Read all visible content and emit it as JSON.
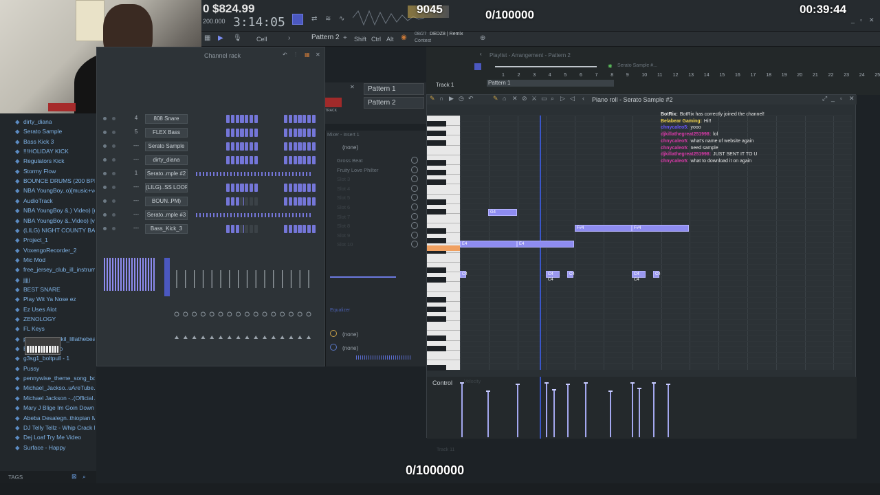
{
  "overlay": {
    "money": "$824.99",
    "money_prefix": "0",
    "counter_center": "9045",
    "goal_top": "0/100000",
    "timer": "00:39:44",
    "goal_bottom": "0/1000000"
  },
  "toolbar": {
    "song_time": "3:14:05",
    "tempo": "200.000",
    "tool_cell": "Cell",
    "pattern": "Pattern 2",
    "shift": "Shift",
    "ctrl": "Ctrl",
    "alt": "Alt",
    "hint_date": "08/27",
    "hint_title": "DEDZ8 | Remix",
    "hint_sub": "Contest"
  },
  "browser": {
    "items": [
      "dirty_diana",
      "Serato Sample",
      "Bass Kick 3",
      "!!!HOLIDAY KICK",
      "Regulators Kick",
      "Stormy Flow",
      "BOUNCE DRUMS (200 BPM)",
      "NBA YoungBoy..o)[music+vocals]",
      "AudioTrack",
      "NBA YoungBoy &.) Video) [music]",
      "NBA YoungBoy &..Video) [vocals]",
      "(LILG) NIGHT COUNTY BASS LOOP",
      "Project_1",
      "VoxengoRecorder_2",
      "Mic Mod",
      "free_jersey_club_ill_instrumental",
      "jjjjj",
      "BEST SNARE",
      "Play Wit Ya Nose ez",
      "Ez Uses Alot",
      "ZENOLOGY",
      "FL Keys",
      "penny (prod.djkil_lillathebeatplug",
      "Basic 808 Clap",
      "g3sg1_boltpull - 1",
      "Pussy",
      "pennywise_theme_song_bq",
      "Michael_Jackso..uAreTube.com_)",
      "Michael Jackson -..(Official Audio)",
      "Mary J Blige  Im Goin Down",
      "Abeba Desalegn..thiopian Music",
      "DJ Telly Tellz - Whip Crack Loop",
      "Dej Loaf  Try Me Video",
      "Surface - Happy"
    ],
    "tags_label": "TAGS"
  },
  "channel_rack": {
    "title": "Channel rack",
    "rows": [
      {
        "num": "4",
        "name": "808 Snare"
      },
      {
        "num": "5",
        "name": "FLEX Bass"
      },
      {
        "num": "---",
        "name": "Serato Sample"
      },
      {
        "num": "---",
        "name": "dirty_diana"
      },
      {
        "num": "1",
        "name": "Serato..mple #2"
      },
      {
        "num": "---",
        "name": "(LILG)..SS LOOP"
      },
      {
        "num": "---",
        "name": "BOUN..PM)"
      },
      {
        "num": "---",
        "name": "Serato..mple #3"
      },
      {
        "num": "---",
        "name": "Bass_Kick_3"
      }
    ]
  },
  "mixer": {
    "title": "Mixer - Insert 1",
    "slot_none": "(none)",
    "effects": [
      "Gross Beat",
      "Fruity Love Philter",
      "Slot 3",
      "Slot 4",
      "Slot 5",
      "Slot 6",
      "Slot 7",
      "Slot 8",
      "Slot 9",
      "Slot 10"
    ],
    "equalizer": "Equalizer",
    "out_none_1": "(none)",
    "out_none_2": "(none)"
  },
  "pattern_picker": {
    "items": [
      "Pattern 1",
      "Pattern 2"
    ],
    "track_label": "TRACK"
  },
  "playlist": {
    "title": "Playlist - Arrangement - Pattern 2",
    "serato": "Serato Sample #...",
    "track": "Track 1",
    "pattern_clip": "Pattern 1",
    "ruler": [
      "1",
      "2",
      "3",
      "4",
      "5",
      "6",
      "7",
      "8",
      "9",
      "10",
      "11",
      "12",
      "13",
      "14",
      "15",
      "16",
      "17",
      "18",
      "19",
      "20",
      "21",
      "22",
      "23",
      "24",
      "25"
    ]
  },
  "piano_roll": {
    "title": "Piano roll - Serato Sample #2",
    "ruler": [
      "1",
      "2",
      "3",
      "4",
      "5",
      "6",
      "7",
      "8",
      "9",
      "10",
      "11",
      "12",
      "13",
      "14"
    ],
    "notes": [
      {
        "label": "G4"
      },
      {
        "label": "F#4"
      },
      {
        "label": "F#4"
      },
      {
        "label": "E4"
      },
      {
        "label": "E4"
      },
      {
        "label": "C4"
      },
      {
        "label": "C4 C4"
      },
      {
        "label": "C4"
      },
      {
        "label": "C4 C4"
      },
      {
        "label": "C4"
      }
    ],
    "control": "Control",
    "control_hint": "Velocity",
    "octave_labels": [
      "C6",
      "C5",
      "C4",
      "C3"
    ],
    "track_bottom": "Track 11"
  },
  "chat": [
    {
      "user": "BotRix:",
      "text": "BotRix has correctly joined the channel!",
      "color": "#e8e8e8"
    },
    {
      "user": "Belabear Gaming:",
      "text": "Hi!!",
      "color": "#f2d34a"
    },
    {
      "user": "chnycaleo5:",
      "text": "yooo",
      "color": "#6a56ff"
    },
    {
      "user": "djkillathegreat251998:",
      "text": "lol",
      "color": "#d83aa8"
    },
    {
      "user": "chnycaleo5:",
      "text": "what's name of website again",
      "color": "#d83aa8"
    },
    {
      "user": "chnycaleo5:",
      "text": "need sample",
      "color": "#d83aa8"
    },
    {
      "user": "djkillathegreat251998:",
      "text": "JUST SENT IT TO U",
      "color": "#d83aa8"
    },
    {
      "user": "chnycaleo5:",
      "text": "what to download it on again",
      "color": "#d83aa8"
    }
  ],
  "colors": {
    "accent": "#7476d8",
    "note": "#8e8cf0",
    "playhead": "#3a56c8",
    "bg": "#1d2226"
  }
}
